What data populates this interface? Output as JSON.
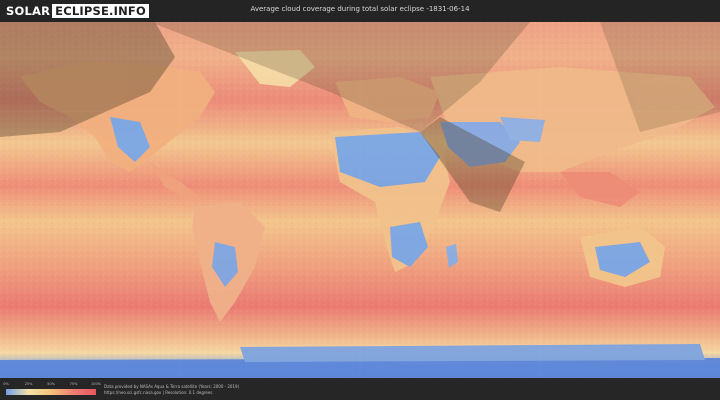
{
  "header": {
    "logo_left": "SOLAR",
    "logo_right": "ECLIPSE.INFO",
    "title": "Average cloud coverage during total solar eclipse -1831-06-14"
  },
  "legend": {
    "ticks": [
      "0%",
      "25%",
      "50%",
      "75%",
      "100%"
    ],
    "colors": [
      "#6f9fe6",
      "#f4e3a7",
      "#f4c27a",
      "#ef7d73",
      "#e8575f"
    ]
  },
  "footer": {
    "credit_line_1": "Data provided by NASAs Aqua & Terra satellite (Years: 2000 - 2019)",
    "credit_line_2": "https://neo.sci.gsfc.nasa.gov  |  Resolution: 0.1 degrees"
  },
  "map": {
    "palette": {
      "clear": "#7aa7e6",
      "low": "#f3d69a",
      "mid": "#f3b57f",
      "high": "#ee8774",
      "overcast": "#e96c6c",
      "antarctica": "#5d87d9",
      "shadow": "#4a3b22"
    }
  }
}
